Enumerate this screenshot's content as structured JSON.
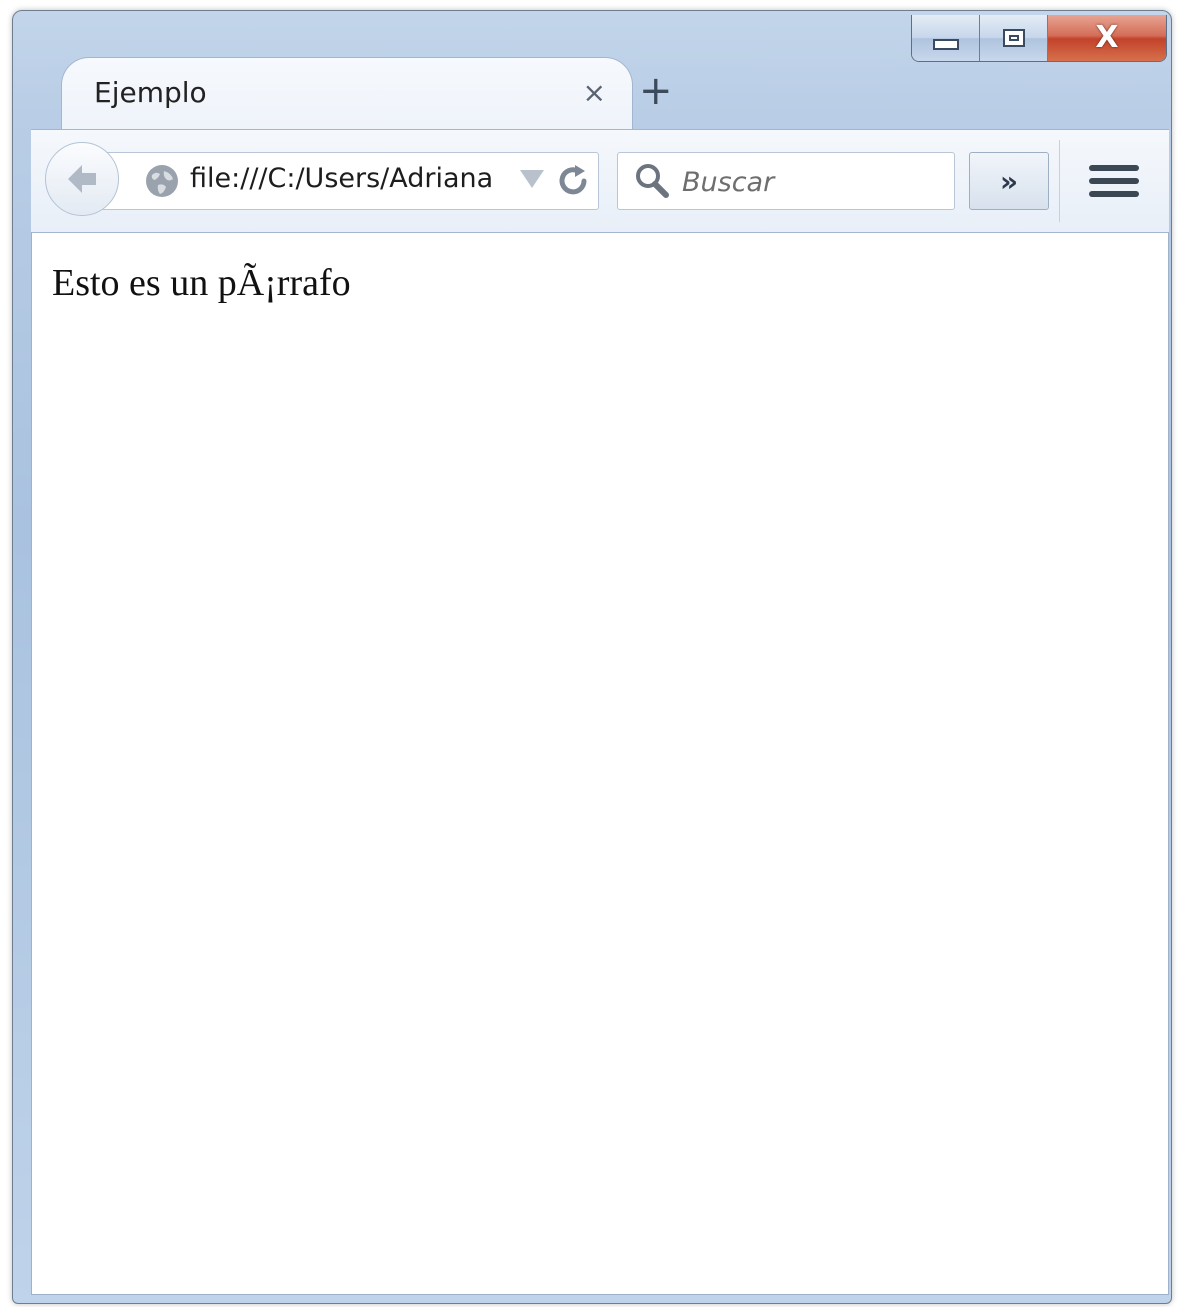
{
  "window": {
    "close_glyph": "X"
  },
  "tab": {
    "title": "Ejemplo",
    "close_glyph": "×",
    "new_tab_glyph": "+"
  },
  "toolbar": {
    "url": "file:///C:/Users/Adriana",
    "search_placeholder": "Buscar",
    "overflow_glyph": "»"
  },
  "content": {
    "paragraph": "Esto es un pÃ¡rrafo"
  },
  "colors": {
    "frame": "#b9cde6",
    "close_button": "#c2432a",
    "toolbar": "#eef3fa",
    "content_bg": "#ffffff"
  }
}
